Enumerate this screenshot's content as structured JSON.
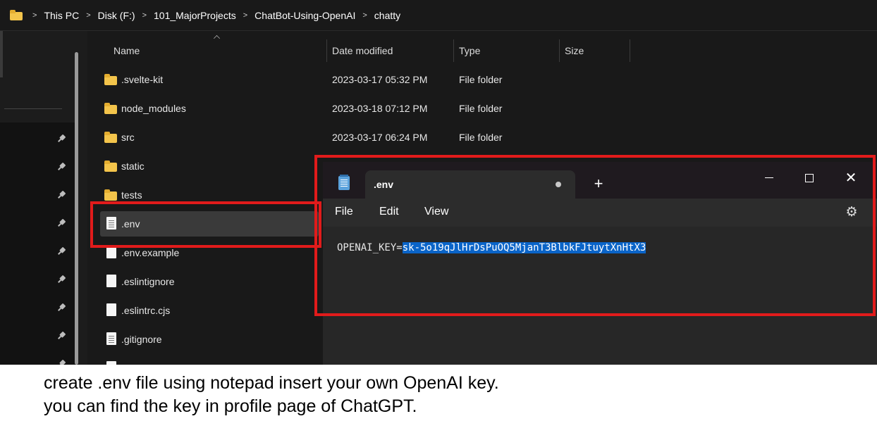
{
  "breadcrumb": {
    "items": [
      "This PC",
      "Disk (F:)",
      "101_MajorProjects",
      "ChatBot-Using-OpenAI",
      "chatty"
    ],
    "separator": ">"
  },
  "columns": {
    "name": "Name",
    "date_modified": "Date modified",
    "type": "Type",
    "size": "Size"
  },
  "files": [
    {
      "name": ".svelte-kit",
      "date": "2023-03-17 05:32 PM",
      "type": "File folder",
      "icon": "folder-icon"
    },
    {
      "name": "node_modules",
      "date": "2023-03-18 07:12 PM",
      "type": "File folder",
      "icon": "folder-icon"
    },
    {
      "name": "src",
      "date": "2023-03-17 06:24 PM",
      "type": "File folder",
      "icon": "folder-icon"
    },
    {
      "name": "static",
      "date": "",
      "type": "",
      "icon": "folder-icon"
    },
    {
      "name": "tests",
      "date": "",
      "type": "",
      "icon": "folder-icon"
    },
    {
      "name": ".env",
      "date": "",
      "type": "",
      "icon": "text-file-icon",
      "selected": true
    },
    {
      "name": ".env.example",
      "date": "",
      "type": "",
      "icon": "file-icon"
    },
    {
      "name": ".eslintignore",
      "date": "",
      "type": "",
      "icon": "file-icon"
    },
    {
      "name": ".eslintrc.cjs",
      "date": "",
      "type": "",
      "icon": "file-icon"
    },
    {
      "name": ".gitignore",
      "date": "",
      "type": "",
      "icon": "text-file-icon"
    }
  ],
  "notepad": {
    "tab_title": ".env",
    "new_tab_label": "+",
    "close_label": "✕",
    "menu": [
      "File",
      "Edit",
      "View"
    ],
    "content_prefix": "OPENAI_KEY=",
    "content_selected": "sk-5o19qJlHrDsPuOQ5MjanT3BlbkFJtuytXnHtX3"
  },
  "caption": {
    "line1": "create .env file using notepad insert your own OpenAI key.",
    "line2": "you can find the key in profile page of ChatGPT."
  },
  "colors": {
    "highlight_red": "#e11b1b",
    "selection_blue": "#0a64c8",
    "folder_yellow": "#f3c44b"
  }
}
